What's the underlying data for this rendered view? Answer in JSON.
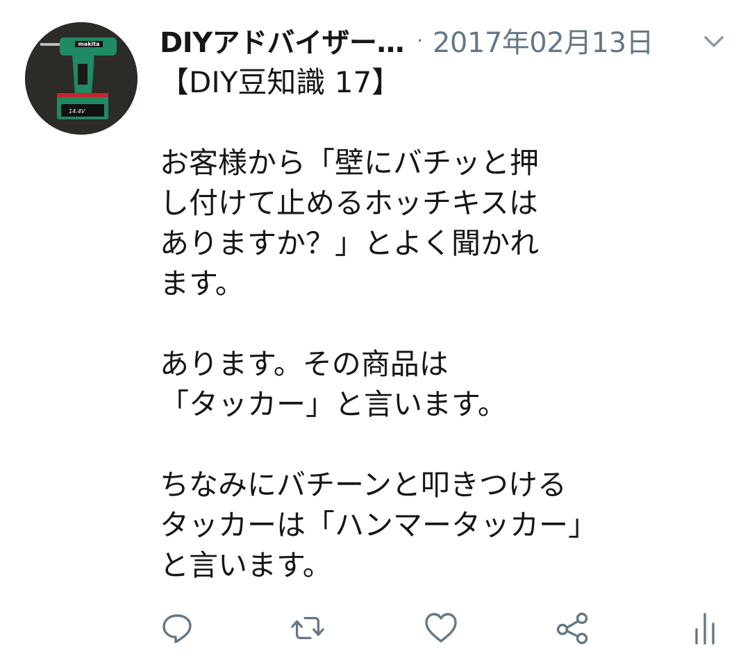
{
  "tweet": {
    "author": {
      "display_name": "DIYアドバイザー…"
    },
    "separator": "·",
    "timestamp": "2017年02月13日",
    "text_lines": [
      "【DIY豆知識 17】",
      "",
      "お客様から「壁にバチッと押",
      "し付けて止めるホッチキスは",
      "ありますか？」とよく聞かれ",
      "ます。",
      "",
      "あります。その商品は",
      "「タッカー」と言います。",
      "",
      "ちなみにバチーンと叩きつける",
      "タッカーは「ハンマータッカー」",
      "と言います。"
    ]
  },
  "avatar": {
    "brand_text": "makita",
    "battery_label": "14.4V"
  },
  "actions": {
    "reply_icon": "reply-icon",
    "retweet_icon": "retweet-icon",
    "like_icon": "heart-icon",
    "share_icon": "share-icon",
    "analytics_icon": "analytics-icon"
  },
  "colors": {
    "text": "#14171a",
    "secondary": "#657786",
    "icon": "#657786",
    "tool_green": "#1f8a63"
  }
}
